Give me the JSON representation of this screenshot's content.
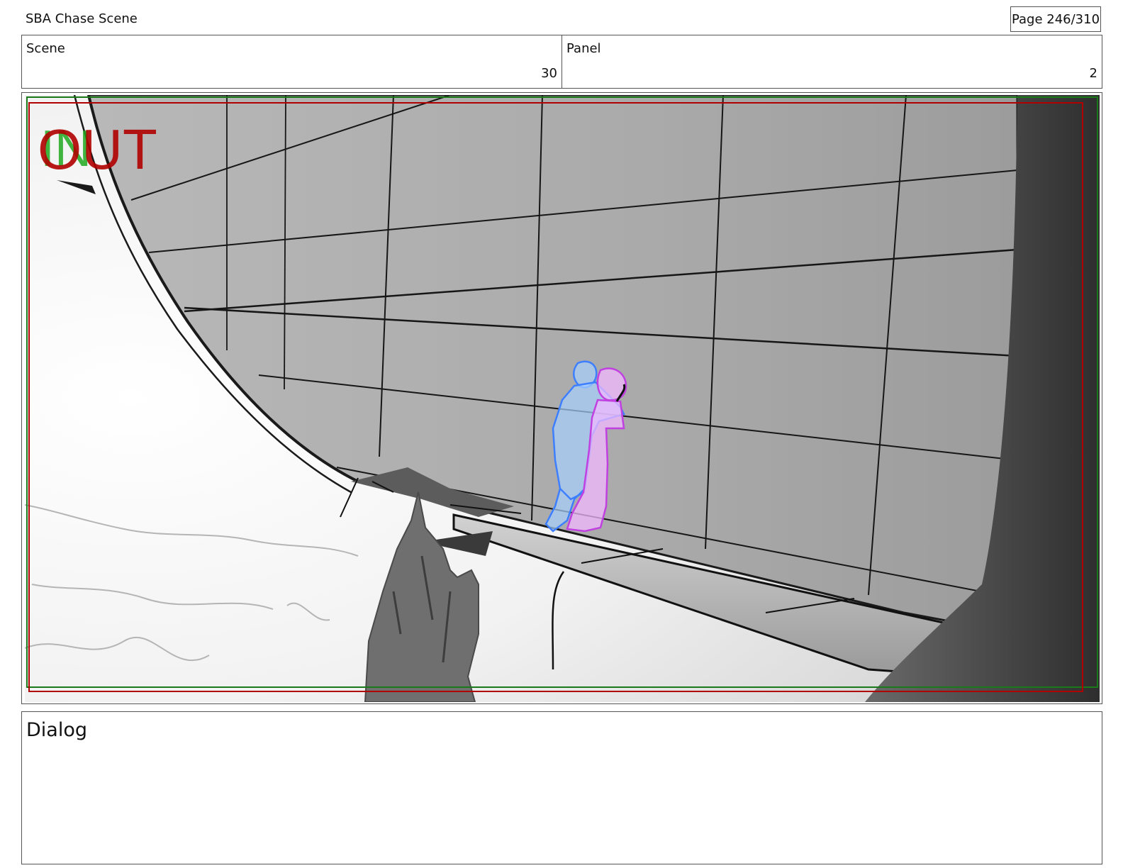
{
  "header": {
    "doc_title": "SBA Chase Scene",
    "page_indicator": "Page 246/310"
  },
  "meta": {
    "scene_label": "Scene",
    "scene_value": "30",
    "panel_label": "Panel",
    "panel_value": "2"
  },
  "frame": {
    "in_marker": "IN",
    "out_marker": "OUT",
    "safe_area_color": "#b00000",
    "title_safe_color": "#1a7a1a"
  },
  "dialog": {
    "label": "Dialog"
  }
}
